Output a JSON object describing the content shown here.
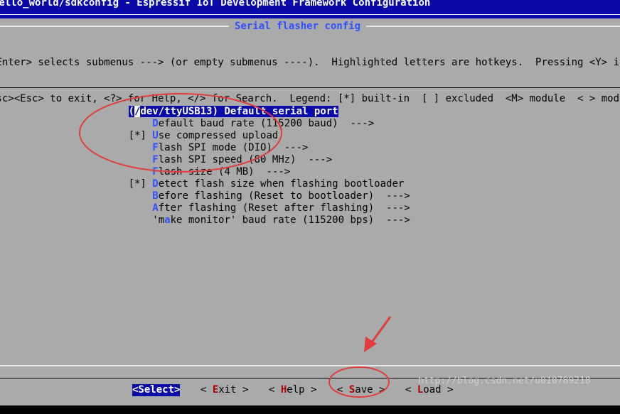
{
  "window": {
    "title": "hello_world/sdkconfig - Espressif IoT Development Framework Configuration"
  },
  "dialog": {
    "title": "Serial flasher config",
    "help_line1": "<Enter> selects submenus ---> (or empty submenus ----).  Highlighted letters are hotkeys.  Pressing <Y> inclu",
    "help_line2": "Esc><Esc> to exit, <?> for Help, </> for Search.  Legend: [*] built-in  [ ] excluded  <M> module  < > module c"
  },
  "menu": {
    "items": [
      {
        "prefix": "(",
        "hot": "/",
        "rest": "dev/ttyUSB13) Default serial port",
        "selected": true
      },
      {
        "prefix": "    ",
        "hot": "D",
        "rest": "efault baud rate (115200 baud)  --->"
      },
      {
        "prefix": "[*] ",
        "hot": "U",
        "rest": "se compressed upload"
      },
      {
        "prefix": "    ",
        "hot": "F",
        "rest": "lash SPI mode (DIO)  --->"
      },
      {
        "prefix": "    ",
        "hot": "F",
        "rest": "lash SPI speed (80 MHz)  --->"
      },
      {
        "prefix": "    ",
        "hot": "F",
        "rest": "lash size (4 MB)  --->"
      },
      {
        "prefix": "[*] ",
        "hot": "D",
        "rest": "etect flash size when flashing bootloader"
      },
      {
        "prefix": "    ",
        "hot": "B",
        "rest": "efore flashing (Reset to bootloader)  --->"
      },
      {
        "prefix": "    ",
        "hot": "A",
        "rest": "fter flashing (Reset after flashing)  --->"
      },
      {
        "prefix": "    'm",
        "hot": "a",
        "rest": "ke monitor' baud rate (115200 bps)  --->"
      }
    ]
  },
  "buttons": {
    "select": "<Select>",
    "exit_pre": "< ",
    "exit_key": "E",
    "exit_rest": "xit >",
    "help_pre": "< ",
    "help_key": "H",
    "help_rest": "elp >",
    "save_pre": "< ",
    "save_key": "S",
    "save_rest": "ave >",
    "load_pre": "< ",
    "load_key": "L",
    "load_rest": "oad >"
  },
  "watermark": "http://blog.csdn.net/u010789218",
  "colors": {
    "background_blue": "#0a0aa8",
    "dialog_gray": "#aaaaaa",
    "hotkey_blue": "#2f50ff",
    "button_hotkey_red": "#b00000",
    "annotation_red": "#e23b3b"
  }
}
